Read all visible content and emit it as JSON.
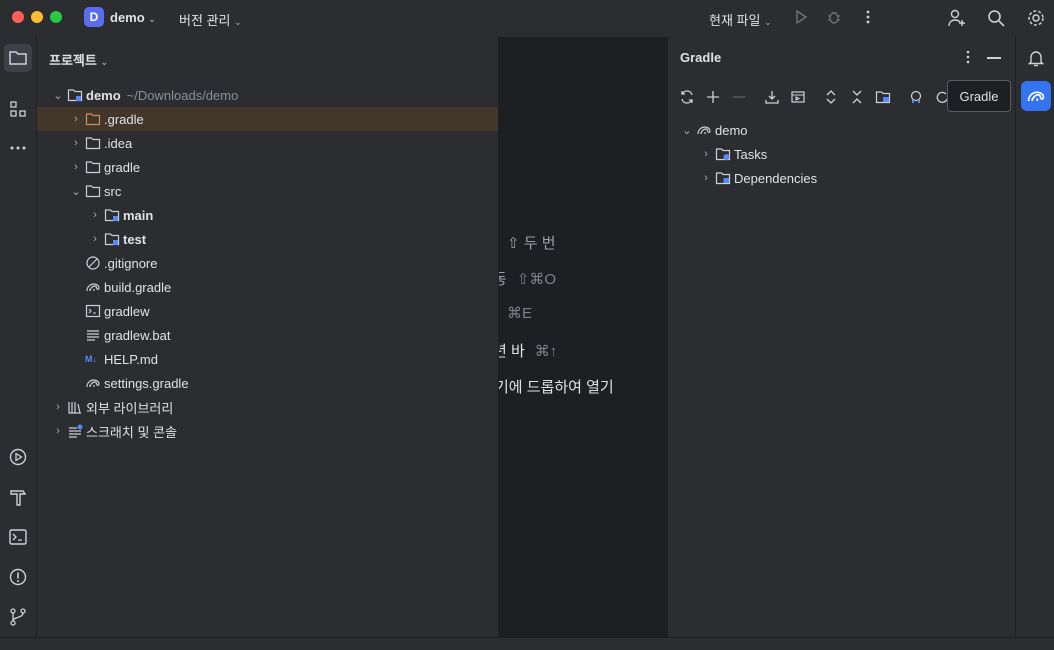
{
  "titlebar": {
    "project_initial": "D",
    "project_name": "demo",
    "vcs_label": "버전 관리",
    "run_config": "현재 파일"
  },
  "project_panel": {
    "title": "프로젝트",
    "root_name": "demo",
    "root_path": "~/Downloads/demo",
    "items": [
      {
        "label": ".gradle"
      },
      {
        "label": ".idea"
      },
      {
        "label": "gradle"
      },
      {
        "label": "src"
      },
      {
        "label": "main"
      },
      {
        "label": "test"
      },
      {
        "label": ".gitignore"
      },
      {
        "label": "build.gradle"
      },
      {
        "label": "gradlew"
      },
      {
        "label": "gradlew.bat"
      },
      {
        "label": "HELP.md"
      },
      {
        "label": "settings.gradle"
      },
      {
        "label": "외부 라이브러리"
      },
      {
        "label": "스크래치 및 콘솔"
      }
    ]
  },
  "editor_hints": [
    {
      "text": "⇧ 두 번",
      "kbd": ""
    },
    {
      "text": "동",
      "kbd": "⇧⌘O"
    },
    {
      "text": "",
      "kbd": "⌘E"
    },
    {
      "text": "년 바",
      "kbd": "⌘↑"
    },
    {
      "text": "기에 드롭하여 열기",
      "kbd": ""
    }
  ],
  "gradle_panel": {
    "title": "Gradle",
    "root": "demo",
    "children": [
      "Tasks",
      "Dependencies"
    ]
  },
  "tooltip": "Gradle",
  "colors": {
    "accent": "#5a6df0",
    "selection": "#43372c",
    "folder_orange": "#d08b5b",
    "module_blue": "#548af7"
  }
}
